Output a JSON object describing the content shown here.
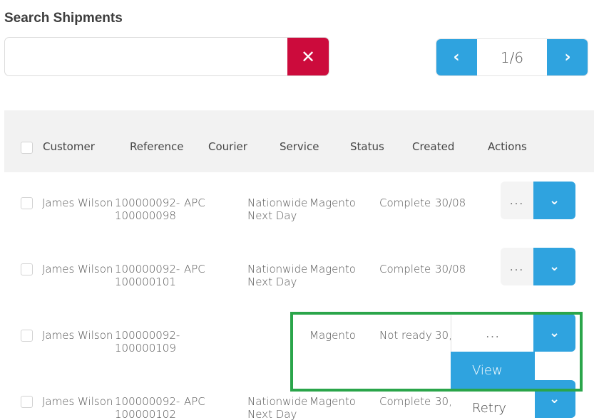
{
  "page": {
    "title": "Search Shipments"
  },
  "search": {
    "value": "",
    "placeholder": "",
    "clear_icon": "close-icon"
  },
  "pager": {
    "label": "1/6",
    "prev_icon": "chevron-left-icon",
    "next_icon": "chevron-right-icon"
  },
  "table": {
    "headers": {
      "customer": "Customer",
      "reference": "Reference",
      "courier": "Courier",
      "service": "Service",
      "status": "Status",
      "created": "Created",
      "actions": "Actions"
    },
    "rows": [
      {
        "customer": "James Wilson",
        "reference_1": "100000092-",
        "reference_2": "100000098",
        "courier": "APC",
        "service_1": "Nationwide",
        "service_2": "Next Day",
        "store": "Magento",
        "status": "Complete",
        "created": "30/08",
        "more": "..."
      },
      {
        "customer": "James Wilson",
        "reference_1": "100000092-",
        "reference_2": "100000101",
        "courier": "APC",
        "service_1": "Nationwide",
        "service_2": "Next Day",
        "store": "Magento",
        "status": "Complete",
        "created": "30/08",
        "more": "..."
      },
      {
        "customer": "James Wilson",
        "reference_1": "100000092-",
        "reference_2": "100000109",
        "courier": "",
        "service_1": "",
        "service_2": "",
        "store": "Magento",
        "status": "Not ready",
        "created": "30,",
        "more": "..."
      },
      {
        "customer": "James Wilson",
        "reference_1": "100000092-",
        "reference_2": "100000102",
        "courier": "APC",
        "service_1": "Nationwide",
        "service_2": "Next Day",
        "store": "Magento",
        "status": "Complete",
        "created": "30,",
        "more": "..."
      }
    ]
  },
  "dropdown": {
    "items": [
      "View",
      "Retry"
    ],
    "active_index": 0
  },
  "colors": {
    "accent": "#2fa3df",
    "danger": "#cc0b3c",
    "highlight": "#2aa54a",
    "header_bg": "#f2f2f2"
  },
  "icons": {
    "toggle": "chevron-down-icon"
  }
}
